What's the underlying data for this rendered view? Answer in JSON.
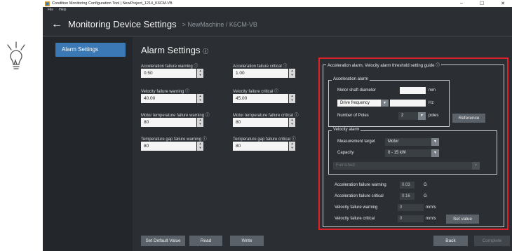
{
  "window": {
    "title": "Condition Monitoring Configuration Tool | NewProject_1214_K6CM-VB",
    "minimize": "–",
    "maximize": "☐",
    "close": "✕"
  },
  "menu": [
    "File",
    "Help"
  ],
  "header": {
    "title": "Monitoring Device Settings",
    "breadcrumb": "> NewMachine / K6CM-VB"
  },
  "sidebar": {
    "item": "Alarm Settings"
  },
  "main": {
    "title": "Alarm Settings",
    "info_glyph": "ⓘ",
    "fields": [
      {
        "label": "Acceleration failure warning ⓘ",
        "value": "0.50"
      },
      {
        "label": "Acceleration failure critical ⓘ",
        "value": "1.00"
      },
      {
        "label": "Velocity failure warning ⓘ",
        "value": "40.00"
      },
      {
        "label": "Velocity failure critical ⓘ",
        "value": "45.00"
      },
      {
        "label": "Motor temperature failure warning ⓘ",
        "value": "80"
      },
      {
        "label": "Motor temperature failure critical ⓘ",
        "value": "80"
      },
      {
        "label": "Temperature gap failure warning ⓘ",
        "value": "80"
      },
      {
        "label": "Temperature gap failure critical ⓘ",
        "value": "80"
      }
    ]
  },
  "guide": {
    "title": "Acceleration alarm, Velocity alarm threshold setting guide ⓘ",
    "accel": {
      "title": "Acceleration alarm",
      "shaft_label": "Motor shaft diameter",
      "shaft_unit": "mm",
      "freq_option": "Drive frequency",
      "freq_unit": "Hz",
      "poles_label": "Number of Poles",
      "poles_value": "2",
      "poles_unit": "poles",
      "reference": "Reference"
    },
    "velocity": {
      "title": "Velocity alarm",
      "target_label": "Measurement target",
      "target_value": "Motor",
      "capacity_label": "Capacity",
      "capacity_value": "0 - 15 kW",
      "furnished": "Furnished"
    },
    "results": [
      {
        "label": "Acceleration failure warning",
        "value": "0.03",
        "unit": "G"
      },
      {
        "label": "Acceleration failure critical",
        "value": "0.16",
        "unit": "G"
      },
      {
        "label": "Velocity failure warning",
        "value": "0",
        "unit": "mm/s"
      },
      {
        "label": "Velocity failure critical",
        "value": "0",
        "unit": "mm/s"
      }
    ],
    "set_value": "Set value"
  },
  "bottom": {
    "default": "Set Default Value",
    "read": "Read",
    "write": "Write",
    "back": "Back",
    "complete": "Complete"
  },
  "colors": {
    "accent": "#3a79b6",
    "highlight_border": "#e0202a",
    "background": "#2b2f33"
  }
}
